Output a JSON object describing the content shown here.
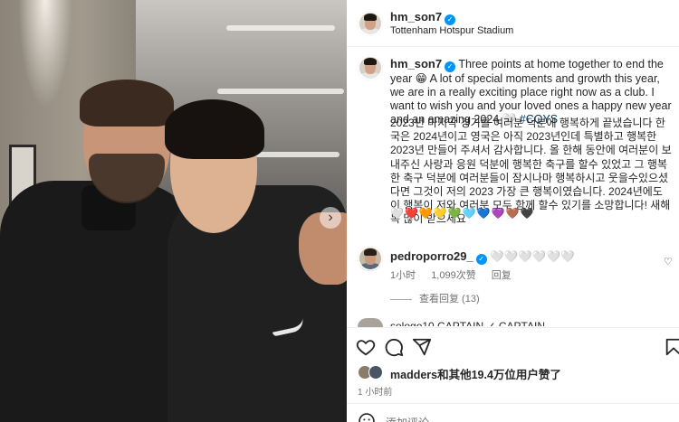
{
  "post": {
    "author": "hm_son7",
    "location": "Tottenham Hotspur Stadium",
    "caption_en": "Three points at home together to end the year 😁 A lot of special moments and growth this year, we are in a really exciting place right now as a club. I want to wish you and your loved ones a happy new year and an amazing 2024 🤍",
    "hashtag": "#COYS",
    "caption_ko": "2023년 마지막 경기를 여러분 덕분에 행복하게 끝냈습니다 한국은 2024년이고 영국은 아직 2023년인데 특별하고 행복한 2023년 만들어 주셔서 감사합니다. 올 한해 동안에 여러분이 보내주신 사랑과 응원 덕분에 행복한 축구를 할수 있었고 그 행복한 축구 덕분에 여러분들이 잠시나마 행복하시고 웃을수있으셨다면 그것이 저의 2023 가장 큰 행복이였습니다. 2024년에도 이 행복이 저와 여러분 모두 함께 할수 있기를 소망합니다! 새해 복 많이 받으세요",
    "caption_hearts": "🤍❤️🧡💛💚🩵💙💜🤎🖤"
  },
  "comment": {
    "user": "pedroporro29_",
    "text": "🤍🤍🤍🤍🤍🤍",
    "time": "1小时",
    "likes": "1,099次赞",
    "reply": "回复",
    "view_replies": "查看回复 (13)"
  },
  "cut_comment": "sologo10  CAPTAIN ✓ CAPTAIN",
  "likes_text": "madders和其他19.4万位用户赞了",
  "timestamp": "1 小时前",
  "add_comment_placeholder": "添加评论...",
  "colors": {
    "verified": "#0095f6",
    "hashtag": "#00376b",
    "secondary": "#737373"
  },
  "icons": [
    "heart-icon",
    "comment-icon",
    "share-icon",
    "bookmark-icon",
    "emoji-icon",
    "next-arrow-icon"
  ]
}
